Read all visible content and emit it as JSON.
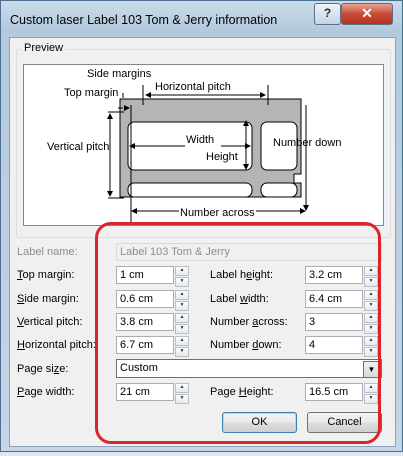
{
  "window": {
    "title": "Custom laser Label 103 Tom & Jerry information",
    "help_label": "?",
    "close_label": "✕"
  },
  "preview": {
    "group_label": "Preview",
    "annotations": {
      "side_margins": "Side margins",
      "top_margin": "Top margin",
      "horizontal_pitch": "Horizontal pitch",
      "vertical_pitch": "Vertical pitch",
      "width": "Width",
      "height": "Height",
      "number_down": "Number down",
      "number_across": "Number across"
    }
  },
  "form": {
    "label_name": {
      "label": "Label name:",
      "value": "Label 103 Tom & Jerry"
    },
    "top_margin": {
      "label_u": "T",
      "label_rest": "op margin:",
      "value": "1 cm"
    },
    "side_margin": {
      "label_u": "S",
      "label_rest": "ide margin:",
      "value": "0.6 cm"
    },
    "vertical_pitch": {
      "label_u": "V",
      "label_rest": "ertical pitch:",
      "value": "3.8 cm"
    },
    "horizontal_pitch": {
      "label_u": "H",
      "label_rest": "orizontal pitch:",
      "value": "6.7 cm"
    },
    "label_height": {
      "label_pre": "Label h",
      "label_u": "e",
      "label_rest": "ight:",
      "value": "3.2 cm"
    },
    "label_width": {
      "label_pre": "Label ",
      "label_u": "w",
      "label_rest": "idth:",
      "value": "6.4 cm"
    },
    "number_across": {
      "label_pre": "Number ",
      "label_u": "a",
      "label_rest": "cross:",
      "value": "3"
    },
    "number_down": {
      "label_pre": "Number ",
      "label_u": "d",
      "label_rest": "own:",
      "value": "4"
    },
    "page_size": {
      "label_pre": "Page si",
      "label_u": "z",
      "label_rest": "e:",
      "value": "Custom"
    },
    "page_width": {
      "label_u": "P",
      "label_rest": "age width:",
      "value": "21 cm"
    },
    "page_height": {
      "label_pre": "Page ",
      "label_u": "H",
      "label_rest": "eight:",
      "value": "16.5 cm"
    }
  },
  "buttons": {
    "ok": "OK",
    "cancel": "Cancel"
  },
  "colors": {
    "highlight": "#d9252b",
    "diagram_gray": "#b5b5b5"
  }
}
